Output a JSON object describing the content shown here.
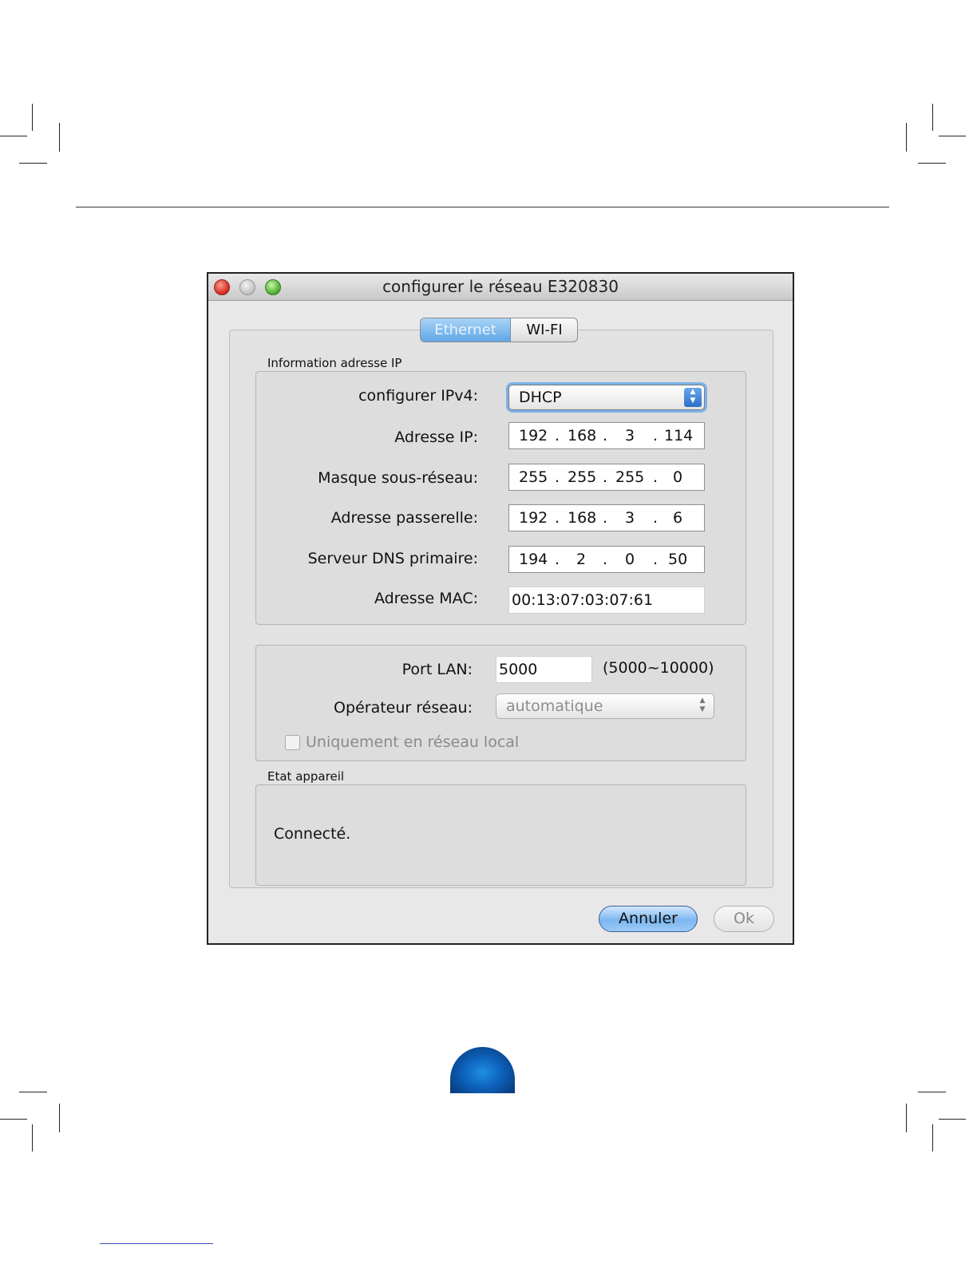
{
  "window": {
    "title": "configurer le réseau E320830"
  },
  "tabs": [
    {
      "label": "Ethernet",
      "selected": true
    },
    {
      "label": "WI-FI",
      "selected": false
    }
  ],
  "ip_info": {
    "group_label": "Information adresse IP",
    "ipv4_label": "configurer IPv4:",
    "ipv4_value": "DHCP",
    "ip_label": "Adresse IP:",
    "ip": [
      "192",
      "168",
      "3",
      "114"
    ],
    "mask_label": "Masque sous-réseau:",
    "mask": [
      "255",
      "255",
      "255",
      "0"
    ],
    "gateway_label": "Adresse passerelle:",
    "gateway": [
      "192",
      "168",
      "3",
      "6"
    ],
    "dns_label": "Serveur DNS primaire:",
    "dns": [
      "194",
      "2",
      "0",
      "50"
    ],
    "mac_label": "Adresse MAC:",
    "mac": "00:13:07:03:07:61"
  },
  "lan": {
    "port_label": "Port LAN:",
    "port_value": "5000",
    "port_range": "(5000~10000)",
    "operator_label": "Opérateur réseau:",
    "operator_value": "automatique",
    "local_only_label": "Uniquement en réseau local",
    "local_only_checked": false
  },
  "status": {
    "group_label": "Etat appareil",
    "text": "Connecté."
  },
  "buttons": {
    "cancel": "Annuler",
    "ok": "Ok"
  },
  "colors": {
    "selected_tab": "#5fa6e6",
    "focus_ring": "#7db1ea",
    "close_light": "#d8352a",
    "max_light": "#57b53a",
    "dome": "#0d5fb8"
  }
}
